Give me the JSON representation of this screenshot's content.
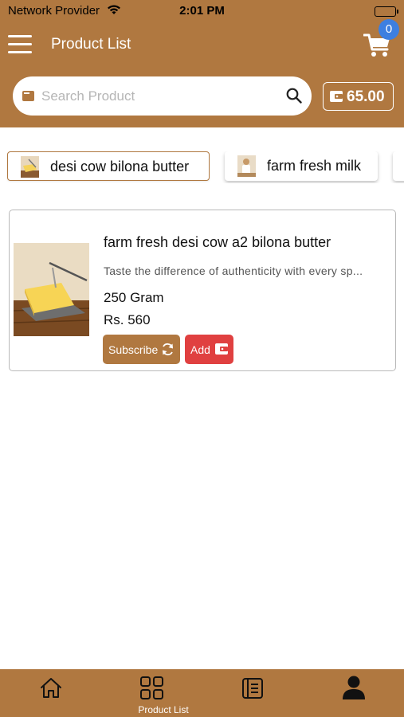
{
  "status_bar": {
    "carrier": "Network Provider",
    "time": "2:01 PM"
  },
  "header": {
    "title": "Product List",
    "cart_count": "0"
  },
  "search": {
    "placeholder": "Search Product"
  },
  "wallet": {
    "amount": "65.00"
  },
  "categories": [
    {
      "label": "desi cow bilona butter",
      "active": true
    },
    {
      "label": "farm fresh milk",
      "active": false
    }
  ],
  "products": [
    {
      "name": "farm fresh desi cow a2 bilona butter",
      "description": "Taste the difference of authenticity with every sp...",
      "quantity": "250 Gram",
      "price": "Rs. 560",
      "subscribe_label": "Subscribe",
      "add_label": "Add"
    }
  ],
  "tabs": [
    {
      "icon": "home-icon",
      "label": ""
    },
    {
      "icon": "grid-icon",
      "label": "Product List"
    },
    {
      "icon": "orders-icon",
      "label": ""
    },
    {
      "icon": "profile-icon",
      "label": ""
    }
  ],
  "colors": {
    "primary": "#b07840",
    "add": "#e04040",
    "badge": "#3d7fe0"
  }
}
